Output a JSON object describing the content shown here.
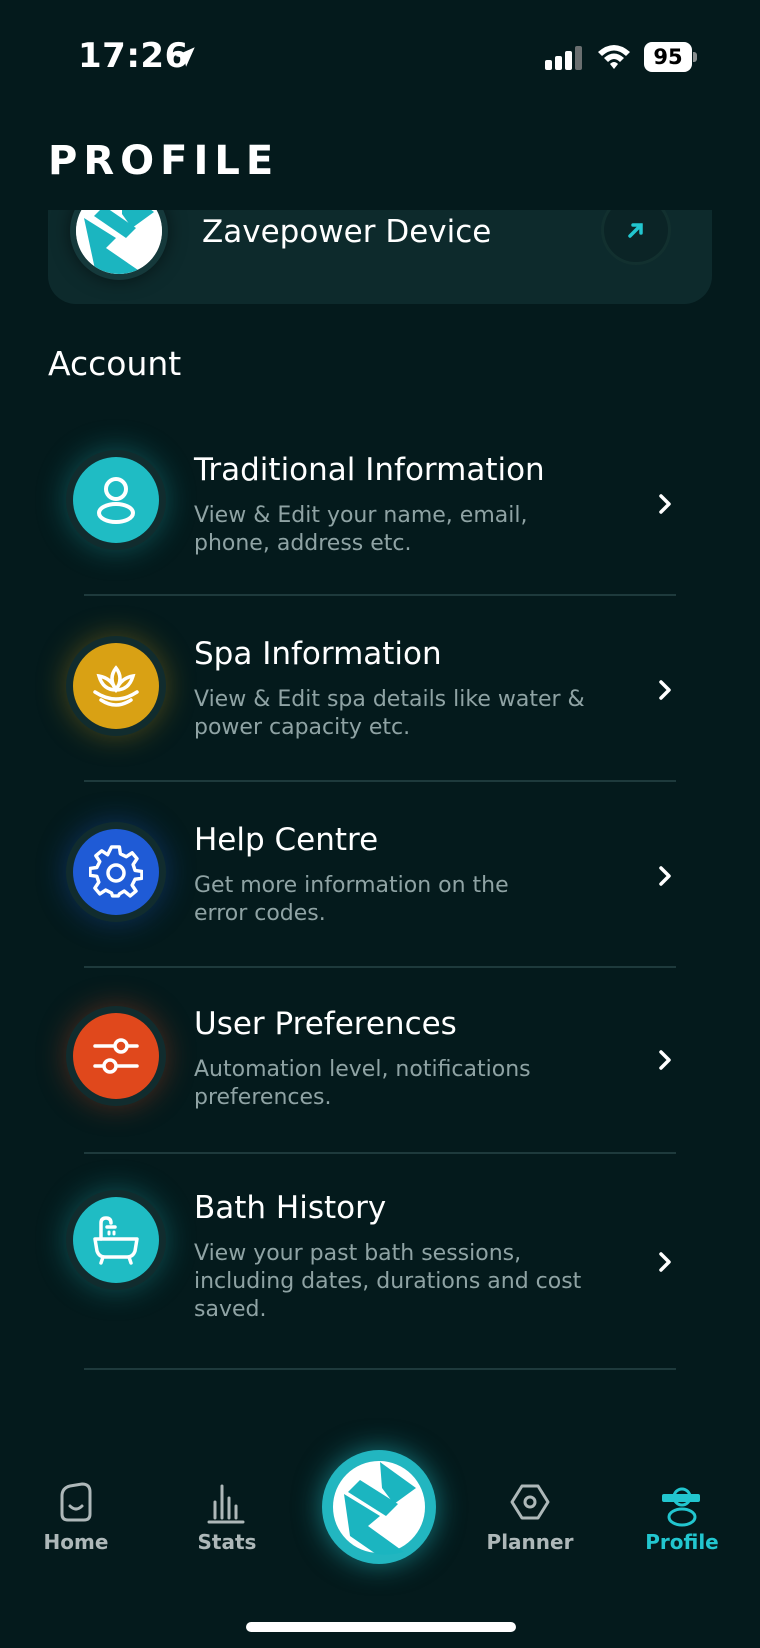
{
  "status_bar": {
    "time": "17:26",
    "battery": "95"
  },
  "header": {
    "title": "PROFILE"
  },
  "device": {
    "name": "Zavepower Device"
  },
  "account": {
    "section_label": "Account",
    "items": [
      {
        "title": "Traditional Information",
        "desc_line1": "View & Edit your name, email,",
        "desc_line2": "phone, address etc.",
        "desc_line3": "",
        "icon": "user-icon",
        "color": "#1fbcc4"
      },
      {
        "title": "Spa Information",
        "desc_line1": "View & Edit spa details like water &",
        "desc_line2": "power capacity etc.",
        "desc_line3": "",
        "icon": "lotus-icon",
        "color": "#d9a114"
      },
      {
        "title": "Help Centre",
        "desc_line1": "Get more information on the",
        "desc_line2": "error codes.",
        "desc_line3": "",
        "icon": "gear-icon",
        "color": "#1f5bd6"
      },
      {
        "title": "User Preferences",
        "desc_line1": "Automation level, notifications",
        "desc_line2": "preferences.",
        "desc_line3": "",
        "icon": "sliders-icon",
        "color": "#e0481c"
      },
      {
        "title": "Bath History",
        "desc_line1": "View your past bath sessions,",
        "desc_line2": "including dates, durations and cost",
        "desc_line3": "saved.",
        "icon": "bathtub-icon",
        "color": "#1fbcc4"
      }
    ]
  },
  "tab_bar": {
    "home": "Home",
    "stats": "Stats",
    "planner": "Planner",
    "profile": "Profile",
    "active": "Profile",
    "accent": "#22c6cf"
  }
}
